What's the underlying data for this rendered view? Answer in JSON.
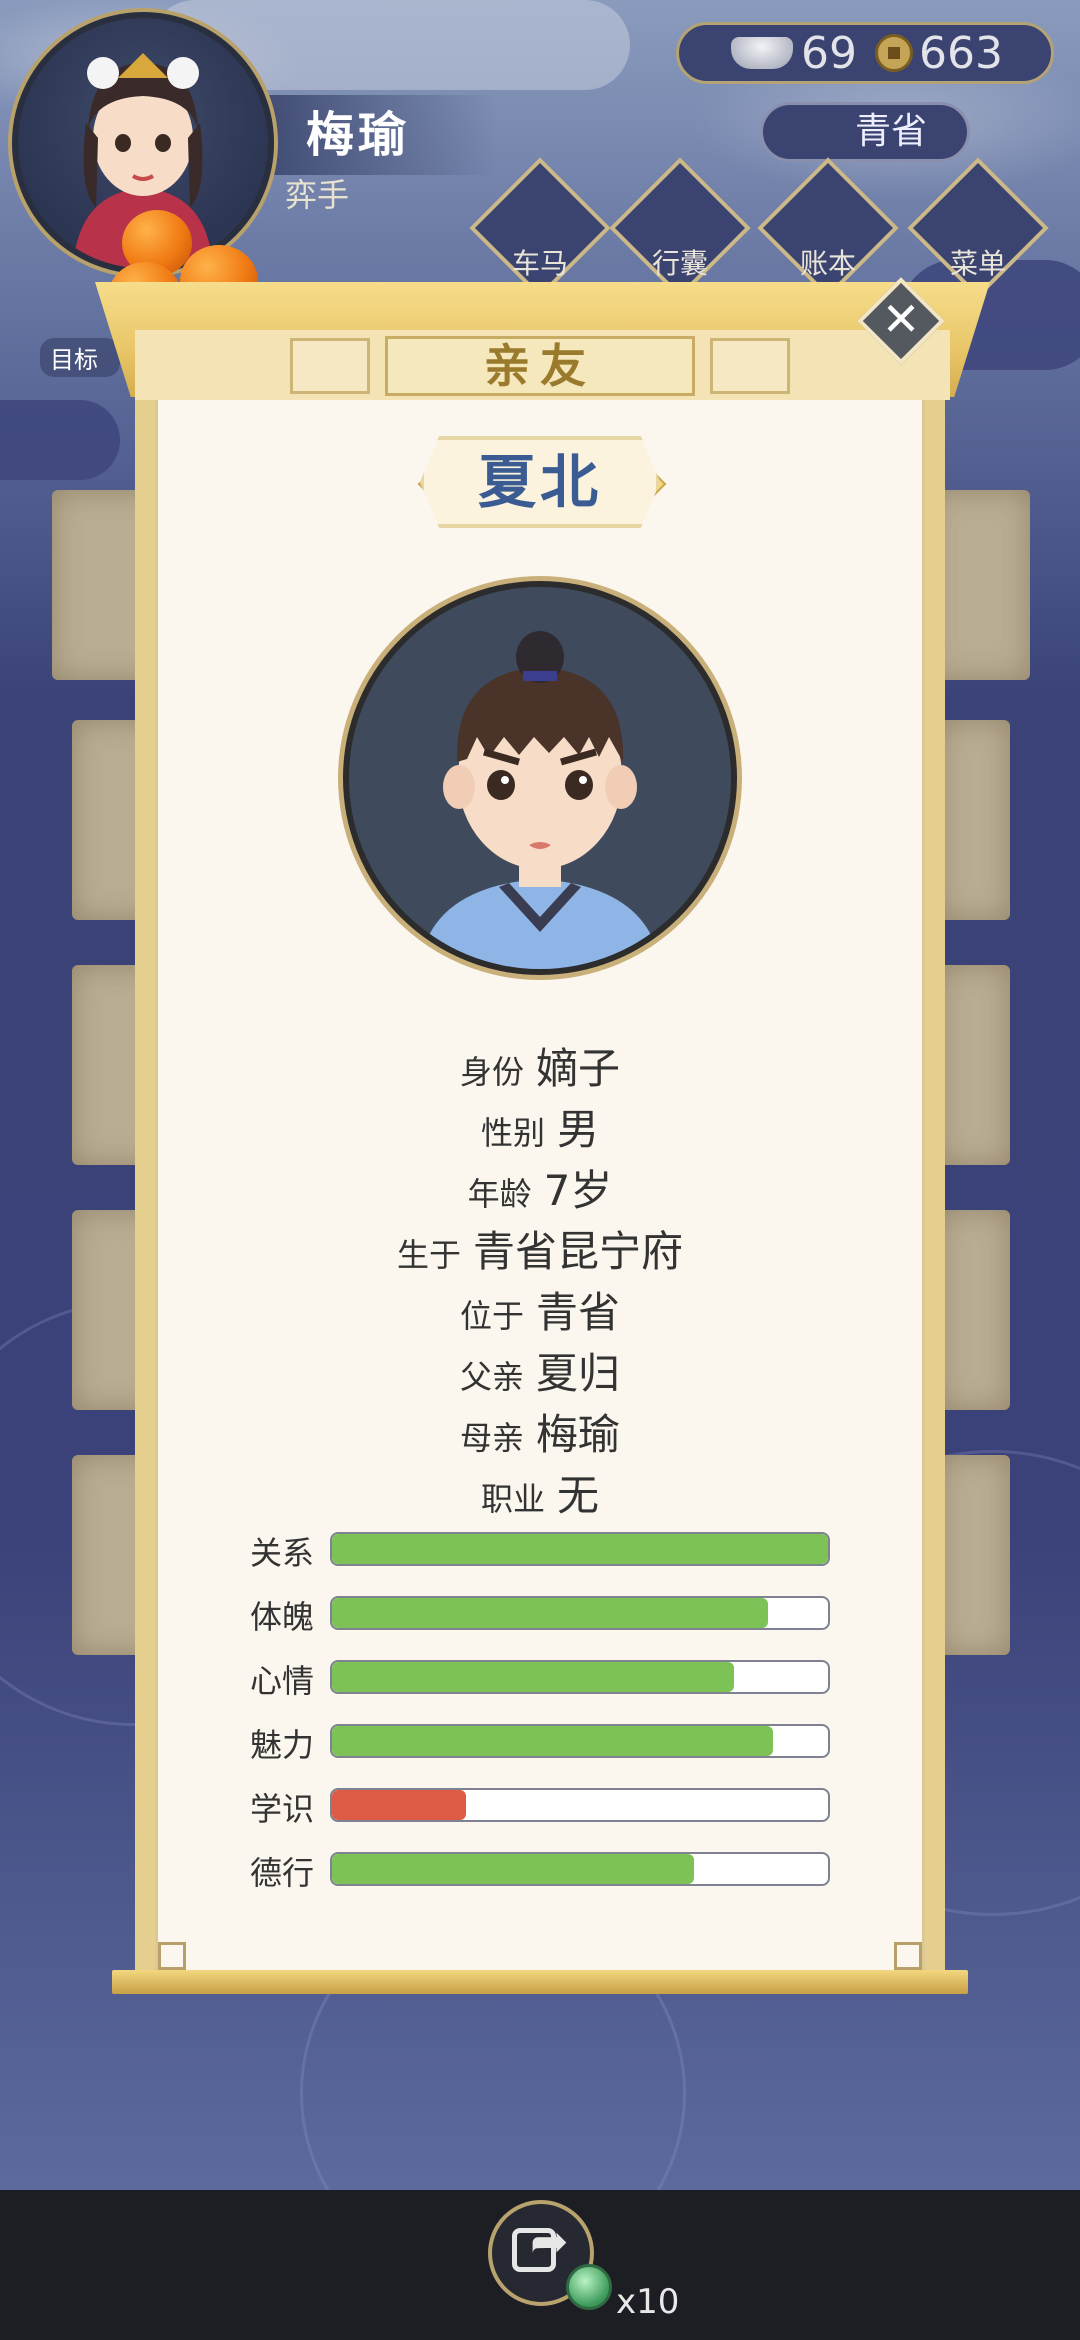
{
  "player": {
    "name": "梅瑜",
    "title": "弈手",
    "goal_label": "目标"
  },
  "currency": {
    "silver": "69",
    "coins": "663"
  },
  "location": "青省",
  "nav": [
    {
      "label": "车马"
    },
    {
      "label": "行囊"
    },
    {
      "label": "账本"
    },
    {
      "label": "菜单"
    }
  ],
  "modal": {
    "title": "亲友",
    "close_icon": "close-icon",
    "character": {
      "name": "夏北",
      "info": [
        {
          "key": "身份",
          "value": "嫡子"
        },
        {
          "key": "性别",
          "value": "男"
        },
        {
          "key": "年龄",
          "value": "7岁"
        },
        {
          "key": "生于",
          "value": "青省昆宁府"
        },
        {
          "key": "位于",
          "value": "青省"
        },
        {
          "key": "父亲",
          "value": "夏归"
        },
        {
          "key": "母亲",
          "value": "梅瑜"
        },
        {
          "key": "职业",
          "value": "无"
        }
      ],
      "stats": [
        {
          "label": "关系",
          "value": 1.0,
          "color": "#7cc257"
        },
        {
          "label": "体魄",
          "value": 0.88,
          "color": "#7cc257"
        },
        {
          "label": "心情",
          "value": 0.81,
          "color": "#7cc257"
        },
        {
          "label": "魅力",
          "value": 0.89,
          "color": "#7cc257"
        },
        {
          "label": "学识",
          "value": 0.27,
          "color": "#e05b45"
        },
        {
          "label": "德行",
          "value": 0.73,
          "color": "#7cc257"
        }
      ]
    }
  },
  "bottom": {
    "share_icon": "share-icon",
    "ad_reward_icon": "jade-icon",
    "ad_count": "x10"
  }
}
